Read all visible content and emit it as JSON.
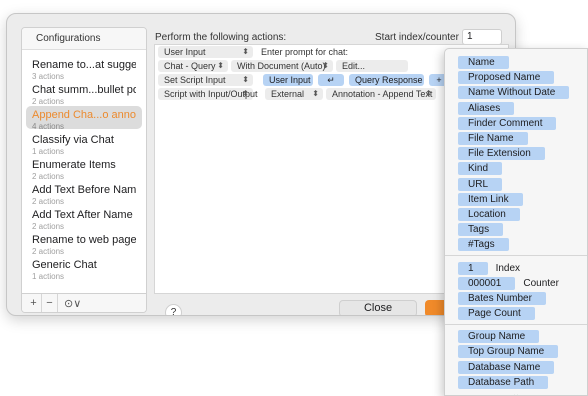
{
  "configurations": {
    "header": "Configurations",
    "items": [
      {
        "name": "Rename to...at suggestion",
        "sub": "3 actions"
      },
      {
        "name": "Chat summ...bullet points",
        "sub": "2 actions"
      },
      {
        "name": "Append Cha...o annotation",
        "sub": "4 actions",
        "active": true
      },
      {
        "name": "Classify via Chat",
        "sub": "1 actions"
      },
      {
        "name": "Enumerate Items",
        "sub": "2 actions"
      },
      {
        "name": "Add Text Before Name",
        "sub": "2 actions"
      },
      {
        "name": "Add Text After Name",
        "sub": "2 actions"
      },
      {
        "name": "Rename to web page title",
        "sub": "2 actions"
      },
      {
        "name": "Generic Chat",
        "sub": "1 actions"
      }
    ],
    "footer": {
      "add": "+",
      "remove": "−",
      "more": "⊙∨"
    }
  },
  "actions": {
    "header": "Perform the following actions:",
    "start_label": "Start index/counter at:",
    "start_value": "1",
    "rows": [
      {
        "type": "User Input",
        "param": "Enter prompt for chat:"
      },
      {
        "type": "Chat - Query",
        "option": "With Document (Auto)",
        "param": "Edit..."
      },
      {
        "type": "Set Script Input",
        "tokens": [
          "User Input",
          "↵",
          "Query Response",
          "+"
        ]
      },
      {
        "type": "Script with Input/Output",
        "option": "External",
        "param": "Annotation - Append Text"
      }
    ]
  },
  "buttons": {
    "help": "?",
    "close": "Close"
  },
  "dropdown": {
    "group1": [
      "Name",
      "Proposed Name",
      "Name Without Date",
      "Aliases",
      "Finder Comment",
      "File Name",
      "File Extension",
      "Kind",
      "URL",
      "Item Link",
      "Location",
      "Tags",
      "#Tags"
    ],
    "group2": [
      {
        "pill": "1",
        "label": "Index"
      },
      {
        "pill": "000001",
        "label": "Counter"
      },
      {
        "pill": "Bates Number",
        "label": ""
      },
      {
        "pill": "Page Count",
        "label": ""
      }
    ],
    "group3": [
      "Group Name",
      "Top Group Name",
      "Database Name",
      "Database Path"
    ],
    "more_indicator": "⌄"
  },
  "colors": {
    "accent": "#f08a2a",
    "token_blue": "#b7d3f4",
    "active_item": "#ec8a2e"
  }
}
